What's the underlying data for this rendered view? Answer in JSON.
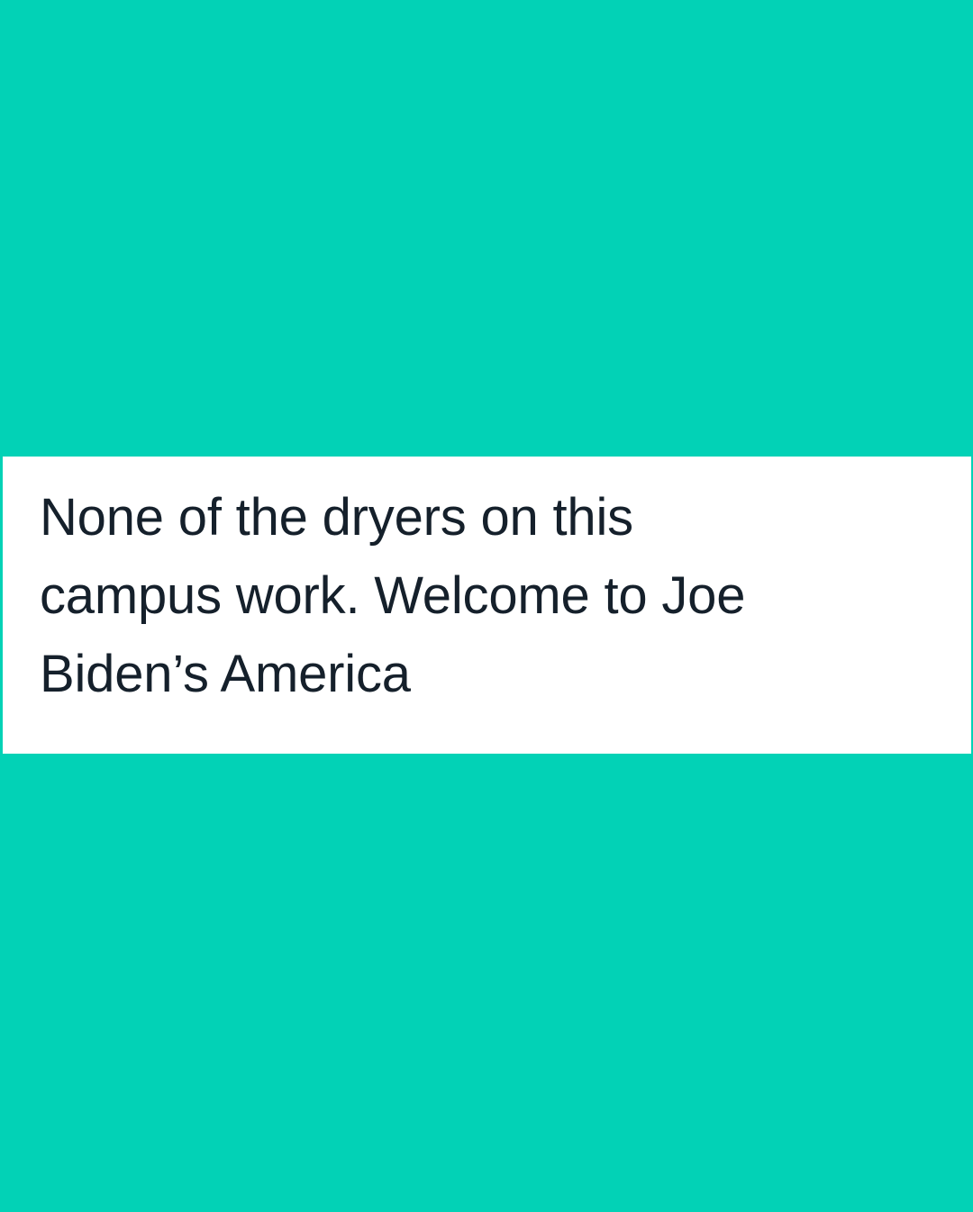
{
  "colors": {
    "background": "#02d2b6",
    "card": "#ffffff",
    "text": "#15202b"
  },
  "post": {
    "lines": [
      "None of the dryers on this",
      "campus work. Welcome to Joe",
      "Biden’s America"
    ]
  }
}
